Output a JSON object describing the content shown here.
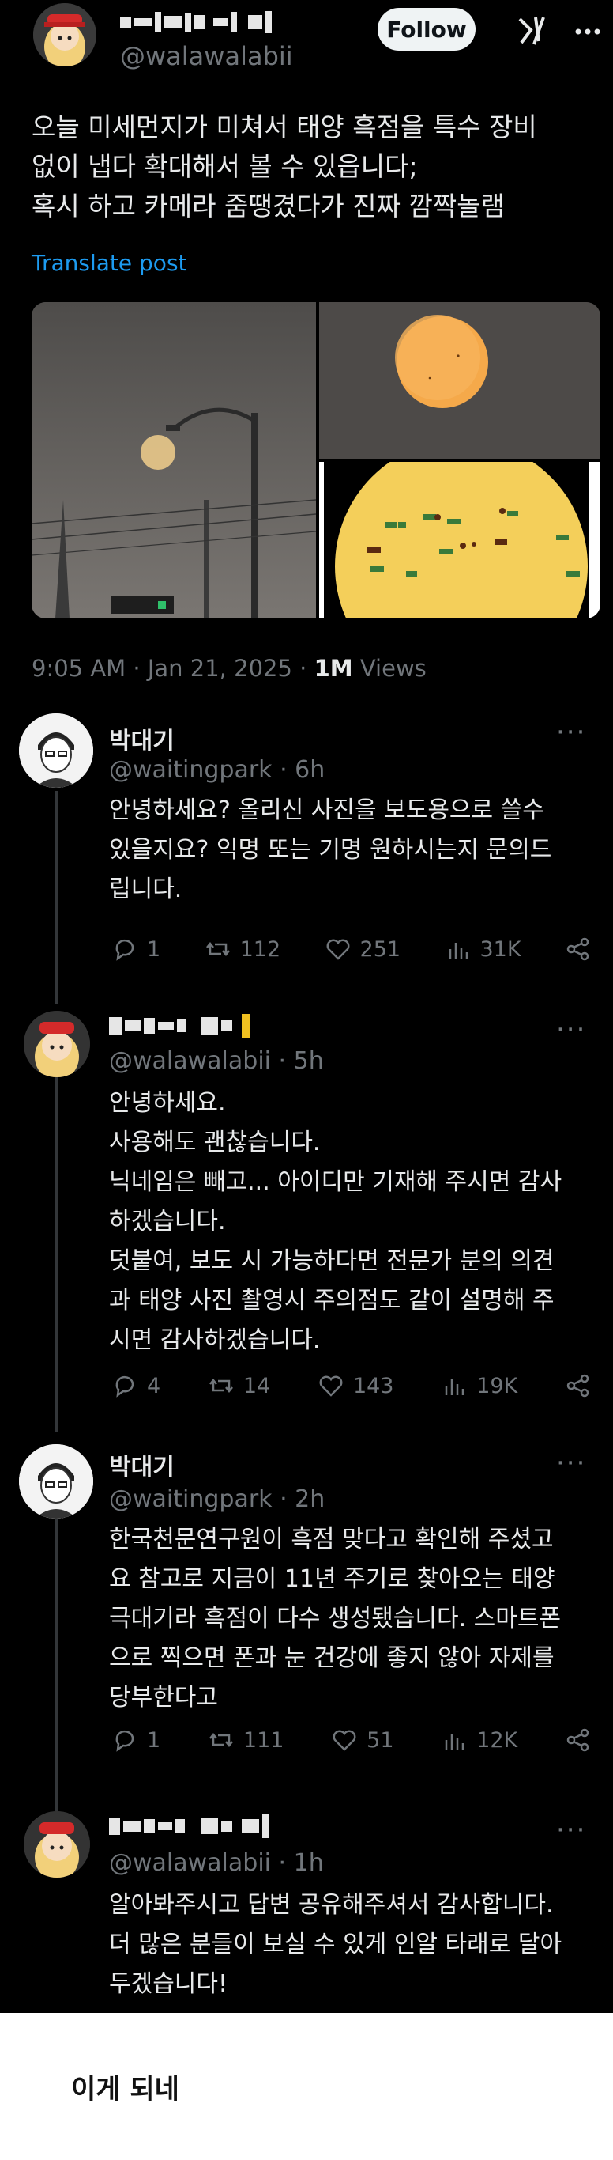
{
  "post": {
    "handle": "@walawalabii",
    "follow_label": "Follow",
    "text": "오늘 미세먼지가 미쳐서 태양 흑점을 특수 장비\n없이 냅다 확대해서 볼 수 있읍니다;\n혹시 하고 카메라 줌땡겼다가 진짜 깜짝놀램",
    "translate_label": "Translate post",
    "time": "9:05 AM · Jan 21, 2025 · ",
    "views_count": "1M",
    "views_label": " Views"
  },
  "replies": [
    {
      "name": "박대기",
      "handle": "@waitingpark",
      "age": "6h",
      "text": "안녕하세요? 올리신 사진을 보도용으로 쓸수\n있을지요? 익명 또는 기명 원하시는지 문의드\n립니다.",
      "replies": "1",
      "reposts": "112",
      "likes": "251",
      "views": "31K"
    },
    {
      "handle": "@walawalabii",
      "age": "5h",
      "text": "안녕하세요.\n사용해도 괜찮습니다.\n닉네임은 빼고... 아이디만 기재해 주시면 감사\n하겠습니다.\n덧붙여, 보도 시 가능하다면 전문가 분의 의견\n과 태양 사진 촬영시 주의점도 같이 설명해 주\n시면 감사하겠습니다.",
      "replies": "4",
      "reposts": "14",
      "likes": "143",
      "views": "19K"
    },
    {
      "name": "박대기",
      "handle": "@waitingpark",
      "age": "2h",
      "text": "한국천문연구원이 흑점 맞다고 확인해 주셨고\n요 참고로 지금이 11년 주기로 찾아오는 태양\n극대기라 흑점이 다수 생성됐습니다. 스마트폰\n으로 찍으면 폰과 눈 건강에 좋지 않아 자제를\n당부한다고",
      "replies": "1",
      "reposts": "111",
      "likes": "51",
      "views": "12K"
    },
    {
      "handle": "@walawalabii",
      "age": "1h",
      "text": "알아봐주시고 답변 공유해주셔서 감사합니다.\n더 많은 분들이 보실 수 있게 인알 타래로 달아\n두겠습니다!"
    }
  ],
  "caption": "이게 되네",
  "colors": {
    "background": "#000000",
    "text": "#e7e9ea",
    "muted": "#71767b",
    "link": "#1d9bf0"
  }
}
